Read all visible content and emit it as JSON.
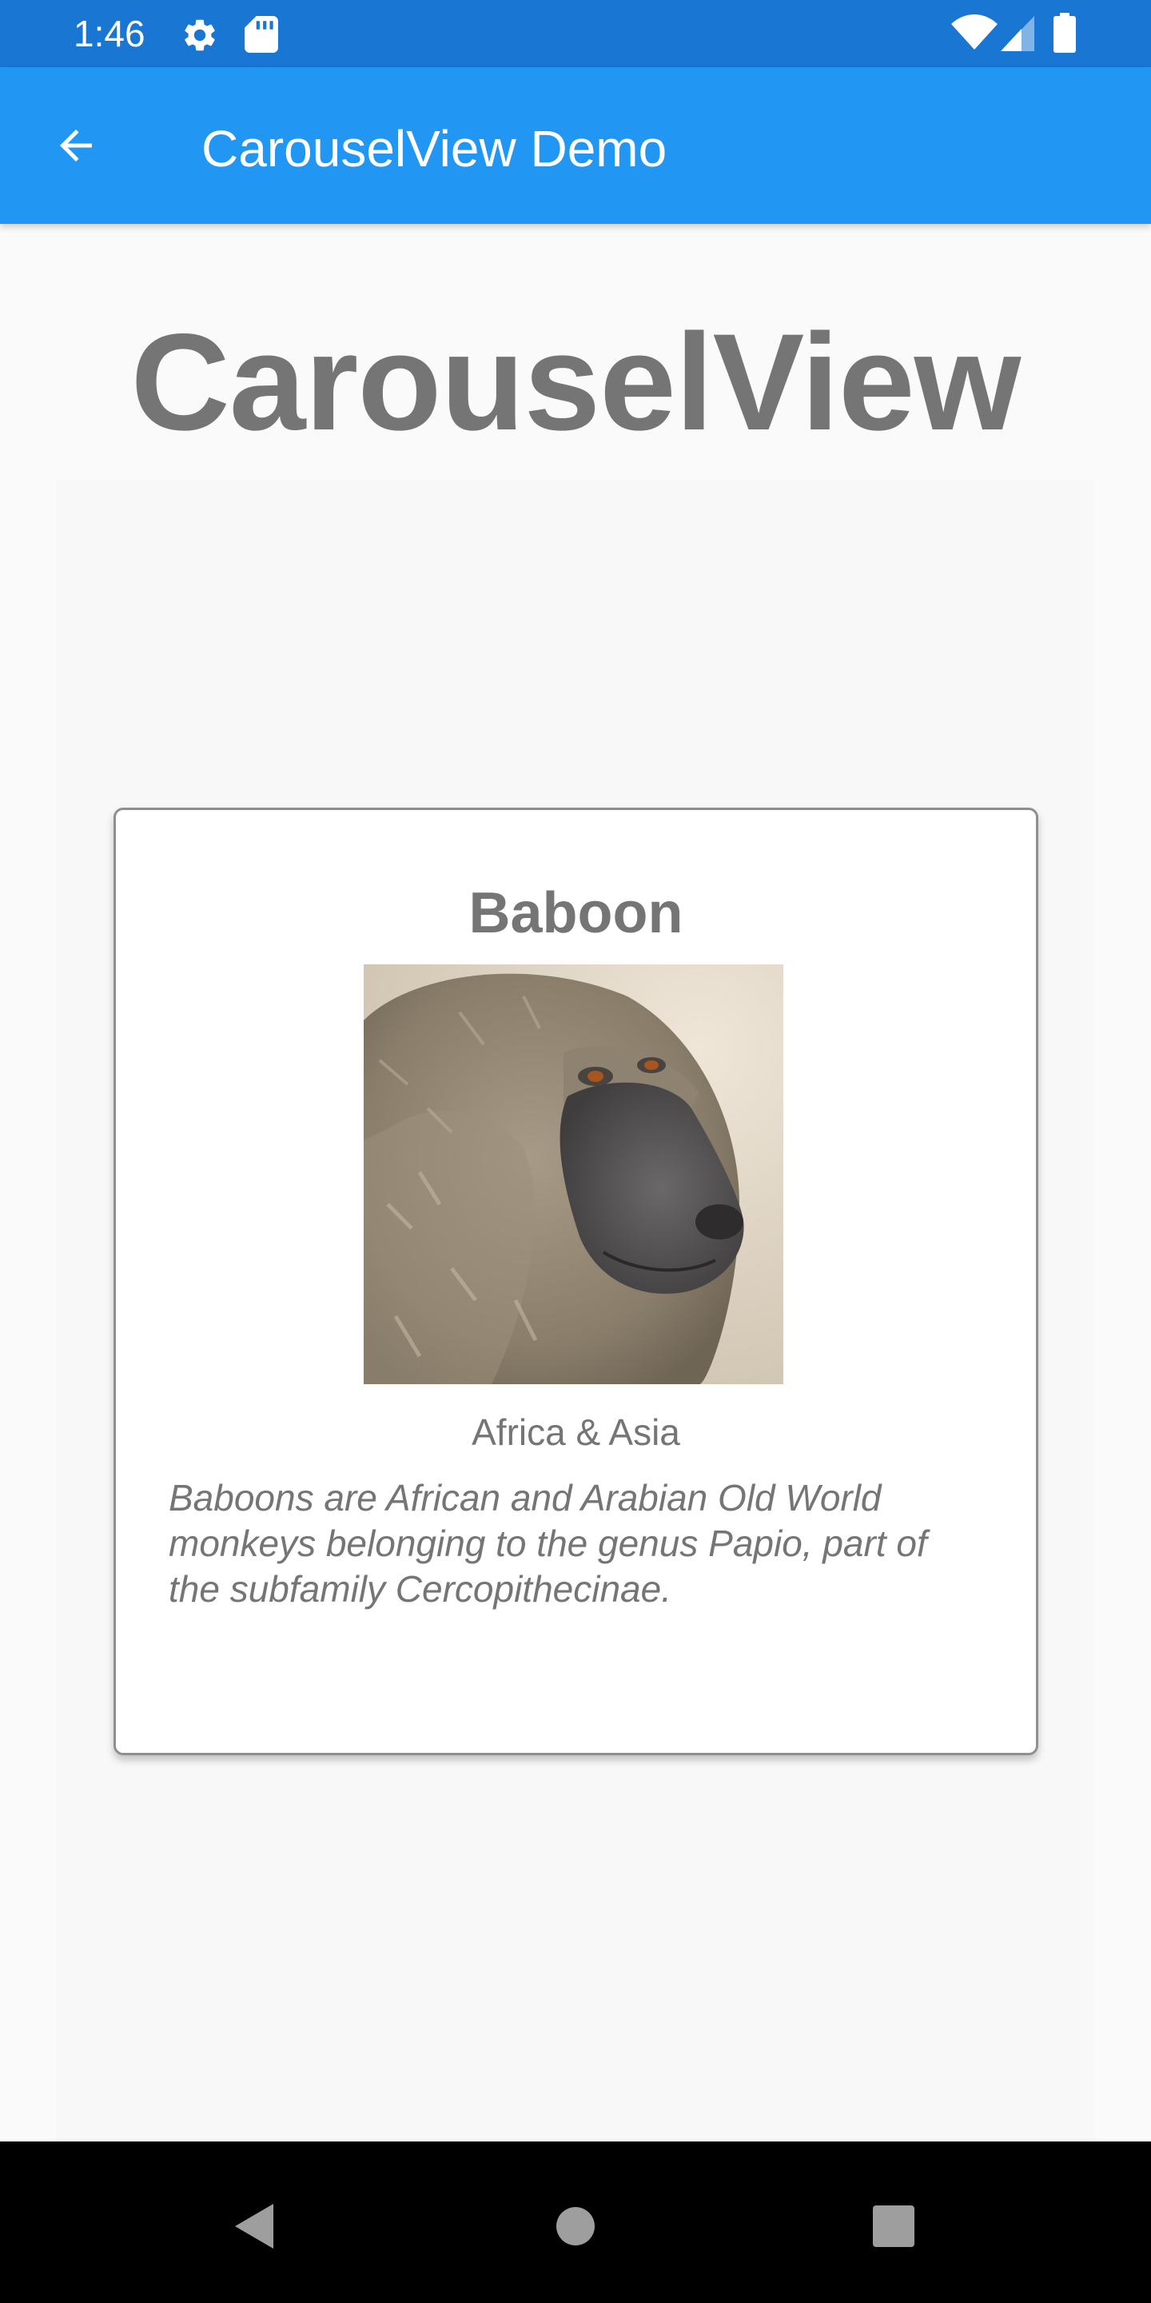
{
  "status_bar": {
    "time": "1:46",
    "icons_left": [
      "gear-icon",
      "sd-card-icon"
    ],
    "icons_right": [
      "wifi-icon",
      "signal-icon",
      "battery-icon"
    ],
    "background": "#1976d2"
  },
  "app_bar": {
    "title": "CarouselView Demo",
    "back_icon": "arrow-left-icon",
    "background": "#2196f3"
  },
  "page": {
    "heading": "CarouselView"
  },
  "carousel": {
    "current_item": {
      "name": "Baboon",
      "image": "baboon-photo",
      "location": "Africa & Asia",
      "details": "Baboons are African and Arabian Old World monkeys belonging to the genus Papio, part of the subfamily Cercopithecinae."
    }
  },
  "nav_bar": {
    "buttons": [
      "back-triangle-icon",
      "home-circle-icon",
      "recents-square-icon"
    ]
  },
  "colors": {
    "text_gray": "#757575",
    "card_border": "#8f8f8f"
  }
}
